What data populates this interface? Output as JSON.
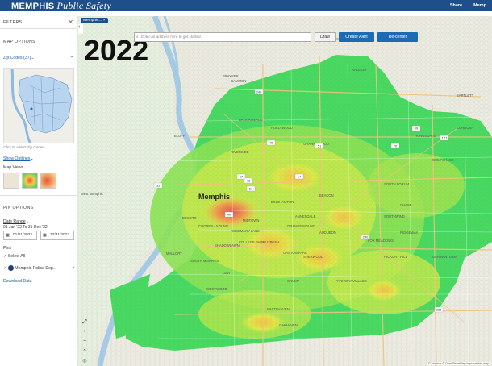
{
  "header": {
    "brand_main": "MEMPHIS",
    "brand_sub": "Public Safety",
    "nav": [
      "Share",
      "Memp"
    ]
  },
  "sidebar": {
    "title": "FILTERS",
    "map_options_title": "MAP OPTIONS",
    "zip_codes_label": "Zip Codes",
    "zip_codes_count": "(37)",
    "click_hint": "Click to select Zip Codes",
    "show_outlines": "Show Outlines",
    "map_views_label": "Map Views",
    "pin_options_title": "PIN OPTIONS",
    "date_range_label": "Date Range",
    "date_range_value": "01 Jan '22 To 31 Dec '22",
    "start_date": "01/01/2022",
    "end_date": "12/31/2022",
    "pins_label": "Pins",
    "select_all": "Select All",
    "pin_item": "Memphis Police Dep...",
    "download": "Download Data"
  },
  "map": {
    "tag": "Memphis...",
    "year_overlay": "2022",
    "search_placeholder": "Enter an address here to get started...",
    "draw_label": "Draw",
    "create_alert_label": "Create Alert",
    "recenter_label": "Re-center",
    "zoom_in": "+",
    "zoom_out": "−",
    "attribution": "© Mapbox © OpenStreetMap Improve this map",
    "city_label": "Memphis",
    "place_labels": [
      "West Memphis",
      "FRAYSER",
      "RALEIGH",
      "BINGHAMTON",
      "BEACON",
      "SOUTHWIND",
      "HICKORY HILL",
      "OAKHAVEN",
      "WHITEHAVEN",
      "GERMANTOWN",
      "MALLORY",
      "COOPER - YOUNG",
      "SOUTH MEMPHIS",
      "MIDTOWN",
      "ORANGE MOUND",
      "ANNESDALE",
      "AUDUBON",
      "NUTBUSH",
      "COLLEGE PARK",
      "WESTWOOD",
      "LEVI",
      "CRUMP",
      "SHERWOOD",
      "PARKWAY VILLAGE",
      "FOX MEADOWS",
      "RIDGEWAY",
      "SOUTH FORUM",
      "WOLFCHASE",
      "CORDOVA",
      "BARTLETT",
      "BROOKMEADE",
      "HOLLYWOOD",
      "GRAHAMWOOD",
      "ROSEMARY LANE",
      "SHADOWLAWN",
      "DESOTO",
      "GASTON PARK",
      "GAMMON",
      "CHARLES SOUTHLAND",
      "KINGSGATE",
      "CHASE",
      "RIVERSIDE",
      "BLUFF"
    ],
    "route_labels": [
      "40",
      "240",
      "55",
      "78",
      "69",
      "385",
      "177",
      "70",
      "51",
      "14",
      "57",
      "61",
      "240",
      "40"
    ]
  },
  "colors": {
    "header_bg": "#1e4f8a",
    "button_bg": "#1d6bb3",
    "heat_low": "#3fd85a",
    "heat_mid": "#d8e94a",
    "heat_high": "#f28c4a",
    "heat_max": "#e8504a"
  }
}
